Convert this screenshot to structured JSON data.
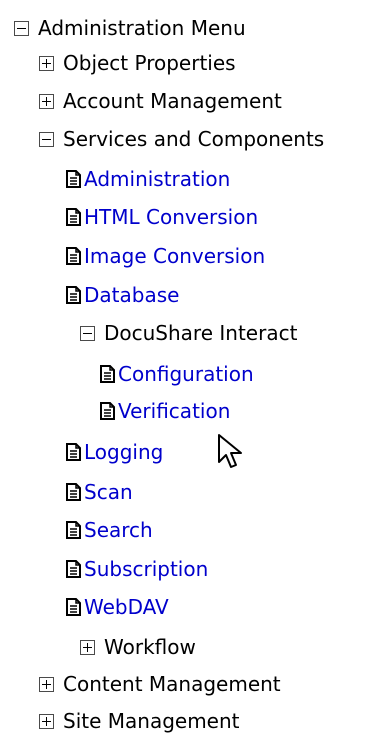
{
  "tree": {
    "root_label": "Administration Menu",
    "object_properties_label": "Object Properties",
    "account_management_label": "Account Management",
    "services_components_label": "Services and Components",
    "administration_label": "Administration",
    "html_conversion_label": "HTML Conversion",
    "image_conversion_label": "Image Conversion",
    "database_label": "Database",
    "docushare_interact_label": "DocuShare Interact",
    "configuration_label": "Configuration",
    "verification_label": "Verification",
    "logging_label": "Logging",
    "scan_label": "Scan",
    "search_label": "Search",
    "subscription_label": "Subscription",
    "webdav_label": "WebDAV",
    "workflow_label": "Workflow",
    "content_management_label": "Content Management",
    "site_management_label": "Site Management"
  },
  "icons": {
    "collapse": "collapse-icon",
    "expand": "expand-icon",
    "document": "document-icon",
    "cursor": "mouse-cursor-icon"
  },
  "colors": {
    "link": "#0000cc",
    "text": "#000000",
    "background": "#ffffff"
  }
}
